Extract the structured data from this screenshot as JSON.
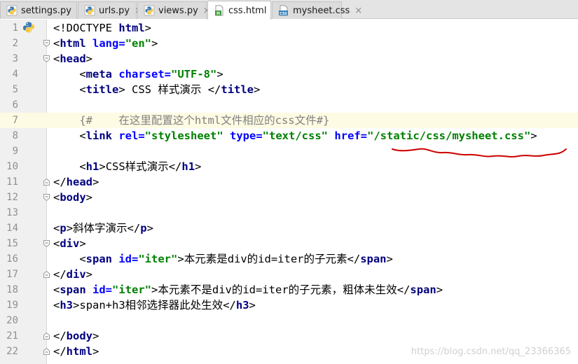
{
  "tabs": [
    {
      "label": "settings.py",
      "icon": "python-icon",
      "active": false
    },
    {
      "label": "urls.py",
      "icon": "python-icon",
      "active": false
    },
    {
      "label": "views.py",
      "icon": "python-icon",
      "active": false
    },
    {
      "label": "css.html",
      "icon": "html-file-icon",
      "active": true
    },
    {
      "label": "mysheet.css",
      "icon": "css-file-icon",
      "active": false
    }
  ],
  "editor": {
    "lines": [
      {
        "num": "1",
        "parts": [
          [
            "p",
            "<"
          ],
          [
            "d",
            "!DOCTYPE "
          ],
          [
            "t",
            "html"
          ],
          [
            "p",
            ">"
          ]
        ]
      },
      {
        "num": "2",
        "parts": [
          [
            "p",
            "<"
          ],
          [
            "t",
            "html "
          ],
          [
            "a",
            "lang="
          ],
          [
            "v",
            "\"en\""
          ],
          [
            "p",
            ">"
          ]
        ]
      },
      {
        "num": "3",
        "parts": [
          [
            "p",
            "<"
          ],
          [
            "t",
            "head"
          ],
          [
            "p",
            ">"
          ]
        ]
      },
      {
        "num": "4",
        "parts": [
          [
            "d",
            "    "
          ],
          [
            "p",
            "<"
          ],
          [
            "t",
            "meta "
          ],
          [
            "a",
            "charset="
          ],
          [
            "v",
            "\"UTF-8\""
          ],
          [
            "p",
            ">"
          ]
        ]
      },
      {
        "num": "5",
        "parts": [
          [
            "d",
            "    "
          ],
          [
            "p",
            "<"
          ],
          [
            "t",
            "title"
          ],
          [
            "p",
            ">"
          ],
          [
            "d",
            " CSS 样式演示 "
          ],
          [
            "p",
            "</"
          ],
          [
            "t",
            "title"
          ],
          [
            "p",
            ">"
          ]
        ]
      },
      {
        "num": "6",
        "parts": []
      },
      {
        "num": "7",
        "parts": [
          [
            "c",
            "    {#    在这里配置这个html文件相应的css文件#}"
          ]
        ]
      },
      {
        "num": "8",
        "parts": [
          [
            "d",
            "    "
          ],
          [
            "p",
            "<"
          ],
          [
            "t",
            "link "
          ],
          [
            "a",
            "rel="
          ],
          [
            "v",
            "\"stylesheet\" "
          ],
          [
            "a",
            "type="
          ],
          [
            "v",
            "\"text/css\" "
          ],
          [
            "a",
            "href="
          ],
          [
            "v",
            "\"/static/css/mysheet.css\""
          ],
          [
            "p",
            ">"
          ]
        ]
      },
      {
        "num": "9",
        "parts": []
      },
      {
        "num": "10",
        "parts": [
          [
            "d",
            "    "
          ],
          [
            "p",
            "<"
          ],
          [
            "t",
            "h1"
          ],
          [
            "p",
            ">"
          ],
          [
            "d",
            "CSS样式演示"
          ],
          [
            "p",
            "</"
          ],
          [
            "t",
            "h1"
          ],
          [
            "p",
            ">"
          ]
        ]
      },
      {
        "num": "11",
        "parts": [
          [
            "p",
            "</"
          ],
          [
            "t",
            "head"
          ],
          [
            "p",
            ">"
          ]
        ]
      },
      {
        "num": "12",
        "parts": [
          [
            "p",
            "<"
          ],
          [
            "t",
            "body"
          ],
          [
            "p",
            ">"
          ]
        ]
      },
      {
        "num": "13",
        "parts": []
      },
      {
        "num": "14",
        "parts": [
          [
            "p",
            "<"
          ],
          [
            "t",
            "p"
          ],
          [
            "p",
            ">"
          ],
          [
            "d",
            "斜体字演示"
          ],
          [
            "p",
            "</"
          ],
          [
            "t",
            "p"
          ],
          [
            "p",
            ">"
          ]
        ]
      },
      {
        "num": "15",
        "parts": [
          [
            "p",
            "<"
          ],
          [
            "t",
            "div"
          ],
          [
            "p",
            ">"
          ]
        ]
      },
      {
        "num": "16",
        "parts": [
          [
            "d",
            "    "
          ],
          [
            "p",
            "<"
          ],
          [
            "t",
            "span "
          ],
          [
            "a",
            "id="
          ],
          [
            "v",
            "\"iter\""
          ],
          [
            "p",
            ">"
          ],
          [
            "d",
            "本元素是div的id=iter的子元素"
          ],
          [
            "p",
            "</"
          ],
          [
            "t",
            "span"
          ],
          [
            "p",
            ">"
          ]
        ]
      },
      {
        "num": "17",
        "parts": [
          [
            "p",
            "</"
          ],
          [
            "t",
            "div"
          ],
          [
            "p",
            ">"
          ]
        ]
      },
      {
        "num": "18",
        "parts": [
          [
            "p",
            "<"
          ],
          [
            "t",
            "span "
          ],
          [
            "a",
            "id="
          ],
          [
            "v",
            "\"iter\""
          ],
          [
            "p",
            ">"
          ],
          [
            "d",
            "本元素不是div的id=iter的子元素，粗体未生效"
          ],
          [
            "p",
            "</"
          ],
          [
            "t",
            "span"
          ],
          [
            "p",
            ">"
          ]
        ]
      },
      {
        "num": "19",
        "parts": [
          [
            "p",
            "<"
          ],
          [
            "t",
            "h3"
          ],
          [
            "p",
            ">"
          ],
          [
            "d",
            "span+h3相邻选择器此处生效"
          ],
          [
            "p",
            "</"
          ],
          [
            "t",
            "h3"
          ],
          [
            "p",
            ">"
          ]
        ]
      },
      {
        "num": "20",
        "parts": []
      },
      {
        "num": "21",
        "parts": [
          [
            "p",
            "</"
          ],
          [
            "t",
            "body"
          ],
          [
            "p",
            ">"
          ]
        ]
      },
      {
        "num": "22",
        "parts": [
          [
            "p",
            "</"
          ],
          [
            "t",
            "html"
          ],
          [
            "p",
            ">"
          ]
        ]
      }
    ],
    "current_line": "7"
  },
  "watermark": "https://blog.csdn.net/qq_23366365",
  "colors": {
    "tag": "#000080",
    "attribute": "#0000ff",
    "value": "#008000",
    "comment": "#808080",
    "annotation": "#cc0000"
  }
}
